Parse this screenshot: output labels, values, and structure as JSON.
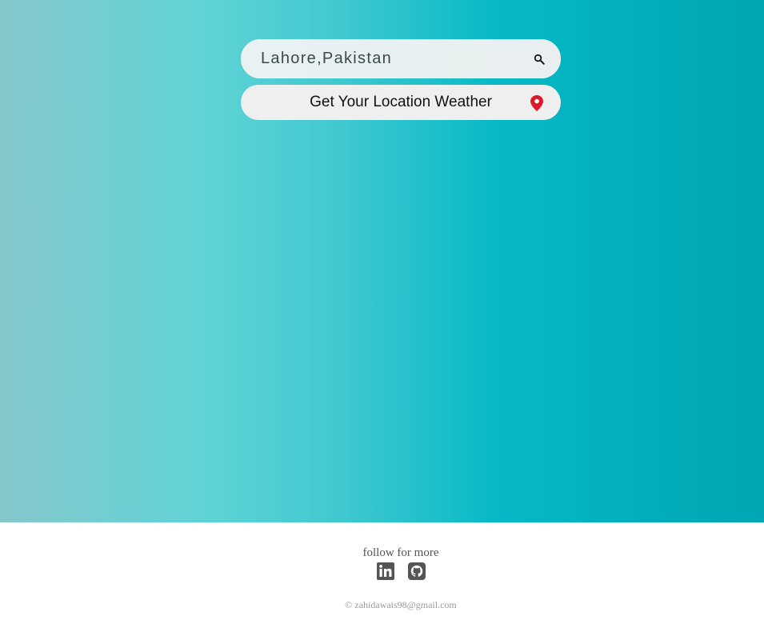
{
  "search": {
    "value": "Lahore,Pakistan",
    "icon": "search-icon"
  },
  "location_button": {
    "label": "Get Your Location Weather",
    "icon": "map-pin-icon",
    "icon_color": "#e0162b"
  },
  "footer": {
    "follow_text": "follow for more",
    "social_links": [
      {
        "icon": "linkedin-icon"
      },
      {
        "icon": "github-icon"
      }
    ],
    "copyright_symbol": "©",
    "email": "zahidawais98@gmail.com"
  },
  "colors": {
    "gradient_left": "#86c8cc",
    "gradient_mid": "#5fd3d6",
    "gradient_right": "#00a6b3"
  }
}
